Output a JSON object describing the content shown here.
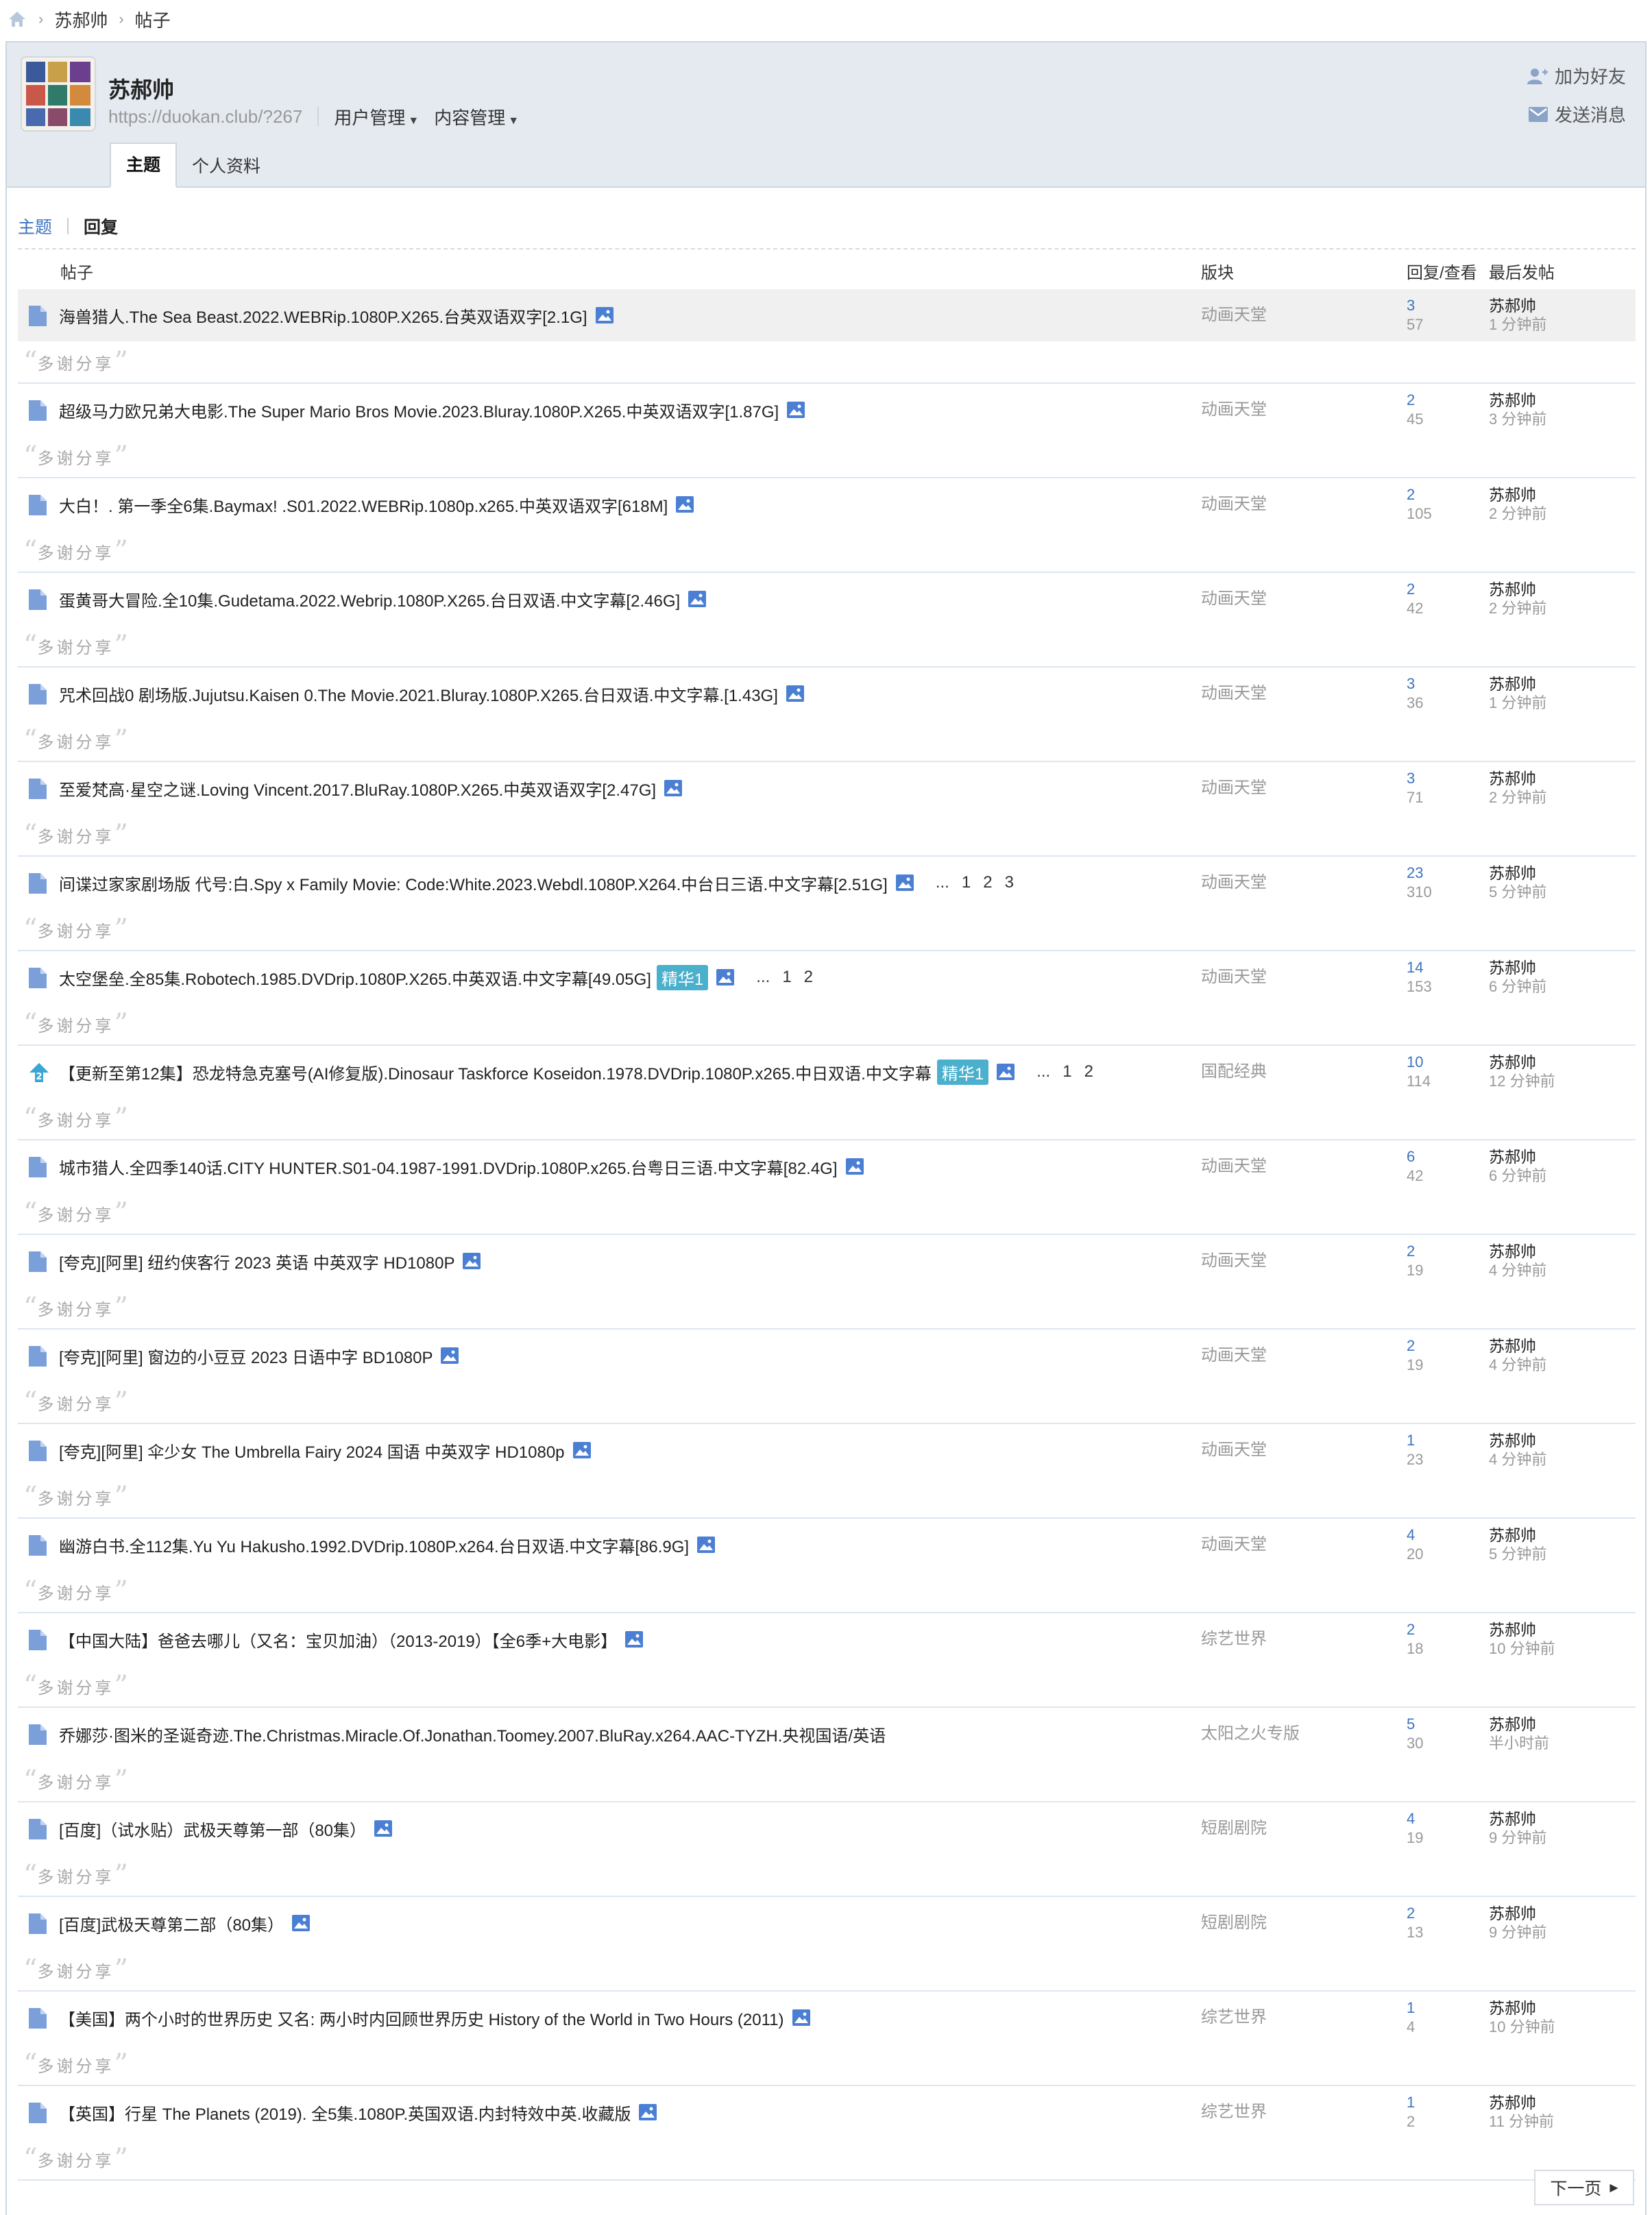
{
  "breadcrumb": {
    "items": [
      "苏郝帅",
      "帖子"
    ]
  },
  "profile": {
    "name": "苏郝帅",
    "url": "https://duokan.club/?267",
    "menus": [
      "用户管理",
      "内容管理"
    ],
    "actions": {
      "add_friend": "加为好友",
      "send_message": "发送消息"
    },
    "tabs": [
      "主题",
      "个人资料"
    ]
  },
  "subtabs": [
    "主题",
    "回复"
  ],
  "table": {
    "headers": {
      "post": "帖子",
      "forum": "版块",
      "stats": "回复/查看",
      "last": "最后发帖"
    },
    "reply_quote": "多谢分享",
    "rows": [
      {
        "title": "海兽猎人.The Sea Beast.2022.WEBRip.1080P.X265.台英双语双字[2.1G]",
        "forum": "动画天堂",
        "replies": "3",
        "views": "57",
        "last_user": "苏郝帅",
        "last_time": "1 分钟前"
      },
      {
        "title": "超级马力欧兄弟大电影.The Super Mario Bros Movie.2023.Bluray.1080P.X265.中英双语双字[1.87G]",
        "forum": "动画天堂",
        "replies": "2",
        "views": "45",
        "last_user": "苏郝帅",
        "last_time": "3 分钟前"
      },
      {
        "title": "大白！. 第一季全6集.Baymax! .S01.2022.WEBRip.1080p.x265.中英双语双字[618M]",
        "forum": "动画天堂",
        "replies": "2",
        "views": "105",
        "last_user": "苏郝帅",
        "last_time": "2 分钟前"
      },
      {
        "title": "蛋黄哥大冒险.全10集.Gudetama.2022.Webrip.1080P.X265.台日双语.中文字幕[2.46G]",
        "forum": "动画天堂",
        "replies": "2",
        "views": "42",
        "last_user": "苏郝帅",
        "last_time": "2 分钟前"
      },
      {
        "title": "咒术回战0 剧场版.Jujutsu.Kaisen 0.The Movie.2021.Bluray.1080P.X265.台日双语.中文字幕.[1.43G]",
        "forum": "动画天堂",
        "replies": "3",
        "views": "36",
        "last_user": "苏郝帅",
        "last_time": "1 分钟前"
      },
      {
        "title": "至爱梵高·星空之谜.Loving Vincent.2017.BluRay.1080P.X265.中英双语双字[2.47G]",
        "forum": "动画天堂",
        "replies": "3",
        "views": "71",
        "last_user": "苏郝帅",
        "last_time": "2 分钟前"
      },
      {
        "title": "间谍过家家剧场版 代号:白.Spy x Family Movie: Code:White.2023.Webdl.1080P.X264.中台日三语.中文字幕[2.51G]",
        "forum": "动画天堂",
        "replies": "23",
        "views": "310",
        "last_user": "苏郝帅",
        "last_time": "5 分钟前",
        "pages": [
          "...",
          "1",
          "2",
          "3"
        ]
      },
      {
        "title": "太空堡垒.全85集.Robotech.1985.DVDrip.1080P.X265.中英双语.中文字幕[49.05G]",
        "badge": "精华1",
        "forum": "动画天堂",
        "replies": "14",
        "views": "153",
        "last_user": "苏郝帅",
        "last_time": "6 分钟前",
        "pages": [
          "...",
          "1",
          "2"
        ]
      },
      {
        "title": "【更新至第12集】恐龙特急克塞号(AI修复版).Dinosaur Taskforce Koseidon.1978.DVDrip.1080P.x265.中日双语.中文字幕",
        "badge": "精华1",
        "special": true,
        "forum": "国配经典",
        "replies": "10",
        "views": "114",
        "last_user": "苏郝帅",
        "last_time": "12 分钟前",
        "pages": [
          "...",
          "1",
          "2"
        ]
      },
      {
        "title": "城市猎人.全四季140话.CITY HUNTER.S01-04.1987-1991.DVDrip.1080P.x265.台粤日三语.中文字幕[82.4G]",
        "forum": "动画天堂",
        "replies": "6",
        "views": "42",
        "last_user": "苏郝帅",
        "last_time": "6 分钟前"
      },
      {
        "title": "[夸克][阿里] 纽约侠客行 2023 英语 中英双字 HD1080P",
        "forum": "动画天堂",
        "replies": "2",
        "views": "19",
        "last_user": "苏郝帅",
        "last_time": "4 分钟前"
      },
      {
        "title": "[夸克][阿里] 窗边的小豆豆 2023 日语中字 BD1080P",
        "forum": "动画天堂",
        "replies": "2",
        "views": "19",
        "last_user": "苏郝帅",
        "last_time": "4 分钟前"
      },
      {
        "title": "[夸克][阿里] 伞少女 The Umbrella Fairy 2024 国语 中英双字 HD1080p",
        "forum": "动画天堂",
        "replies": "1",
        "views": "23",
        "last_user": "苏郝帅",
        "last_time": "4 分钟前"
      },
      {
        "title": "幽游白书.全112集.Yu Yu Hakusho.1992.DVDrip.1080P.x264.台日双语.中文字幕[86.9G]",
        "forum": "动画天堂",
        "replies": "4",
        "views": "20",
        "last_user": "苏郝帅",
        "last_time": "5 分钟前"
      },
      {
        "title": "【中国大陆】爸爸去哪儿（又名：宝贝加油）（2013-2019）【全6季+大电影】",
        "forum": "综艺世界",
        "replies": "2",
        "views": "18",
        "last_user": "苏郝帅",
        "last_time": "10 分钟前"
      },
      {
        "title": "乔娜莎·图米的圣诞奇迹.The.Christmas.Miracle.Of.Jonathan.Toomey.2007.BluRay.x264.AAC-TYZH.央视国语/英语",
        "noimg": true,
        "forum": "太阳之火专版",
        "replies": "5",
        "views": "30",
        "last_user": "苏郝帅",
        "last_time": "半小时前"
      },
      {
        "title": "[百度]（试水贴）武极天尊第一部（80集）",
        "forum": "短剧剧院",
        "replies": "4",
        "views": "19",
        "last_user": "苏郝帅",
        "last_time": "9 分钟前"
      },
      {
        "title": "[百度]武极天尊第二部（80集）",
        "forum": "短剧剧院",
        "replies": "2",
        "views": "13",
        "last_user": "苏郝帅",
        "last_time": "9 分钟前"
      },
      {
        "title": "【美国】两个小时的世界历史 又名: 两小时内回顾世界历史 History of the World in Two Hours (2011)",
        "forum": "综艺世界",
        "replies": "1",
        "views": "4",
        "last_user": "苏郝帅",
        "last_time": "10 分钟前"
      },
      {
        "title": "【英国】行星 The Planets (2019). 全5集.1080P.英国双语.内封特效中英.收藏版",
        "forum": "综艺世界",
        "replies": "1",
        "views": "2",
        "last_user": "苏郝帅",
        "last_time": "11 分钟前"
      }
    ]
  },
  "pagination": {
    "next": "下一页"
  },
  "colors": {
    "link": "#3b73c2",
    "badge": "#4bb0cc",
    "icon": "#4a7fd4"
  }
}
